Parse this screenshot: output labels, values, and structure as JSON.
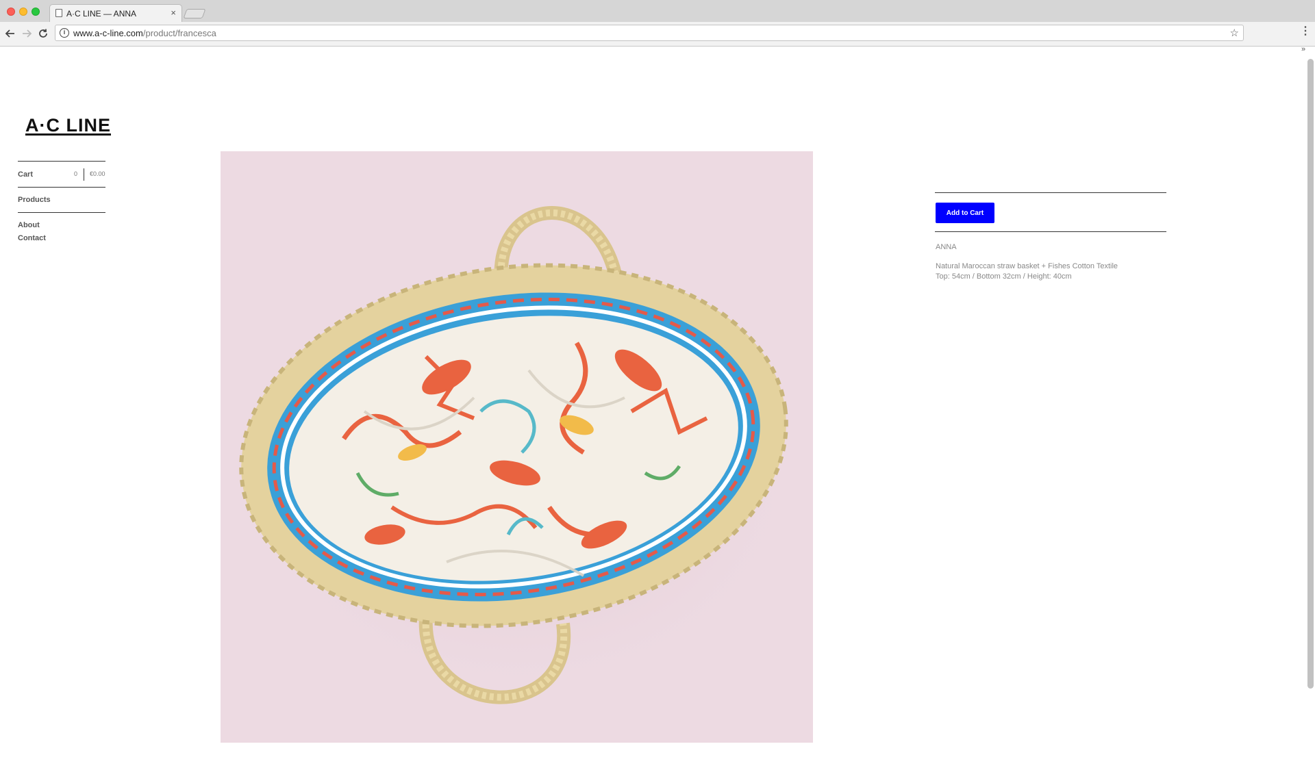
{
  "browser": {
    "tab_title": "A·C LINE — ANNA",
    "tab_close": "×",
    "url_host": "www.a-c-line.com",
    "url_path": "/product/francesca"
  },
  "site": {
    "logo": "A·C LINE"
  },
  "sidebar": {
    "cart_label": "Cart",
    "cart_count": "0",
    "cart_total": "€0.00",
    "products_label": "Products",
    "about_label": "About",
    "contact_label": "Contact"
  },
  "product": {
    "add_to_cart_label": "Add to Cart",
    "name": "ANNA",
    "description_line1": "Natural Maroccan straw basket + Fishes Cotton Textile",
    "description_line2": "Top: 54cm / Bottom 32cm / Height: 40cm",
    "image_background": "#eddae2"
  },
  "colors": {
    "accent_button": "#0000ff"
  }
}
